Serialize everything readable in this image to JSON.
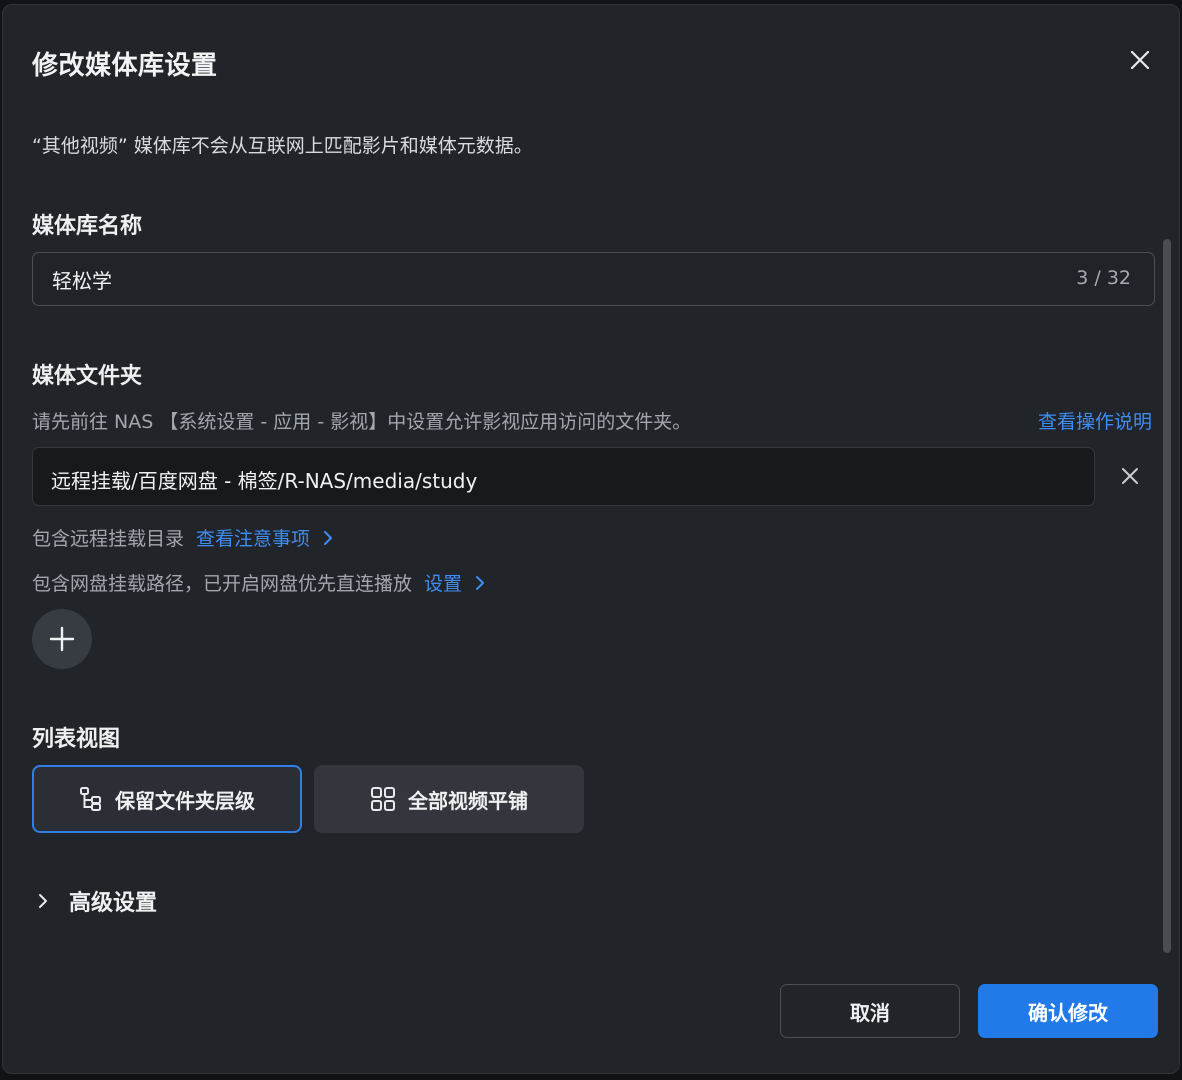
{
  "dialog": {
    "title": "修改媒体库设置",
    "description": "“其他视频” 媒体库不会从互联网上匹配影片和媒体元数据。"
  },
  "library_name": {
    "label": "媒体库名称",
    "value": "轻松学",
    "counter": "3 / 32"
  },
  "media_folder": {
    "label": "媒体文件夹",
    "hint": "请先前往 NAS 【系统设置 - 应用 - 影视】中设置允许影视应用访问的文件夹。",
    "help_link": "查看操作说明",
    "folders": [
      {
        "path": "远程挂载/百度网盘 - 棉签/R-NAS/media/study"
      }
    ],
    "remote_note": "包含远程挂载目录",
    "remote_link": "查看注意事项",
    "netdisk_note": "包含网盘挂载路径，已开启网盘优先直连播放",
    "netdisk_link": "设置"
  },
  "list_view": {
    "label": "列表视图",
    "options": [
      {
        "label": "保留文件夹层级",
        "icon": "folder-tree-icon",
        "selected": true
      },
      {
        "label": "全部视频平铺",
        "icon": "grid-icon",
        "selected": false
      }
    ]
  },
  "advanced": {
    "label": "高级设置"
  },
  "footer": {
    "cancel_label": "取消",
    "confirm_label": "确认修改"
  },
  "colors": {
    "accent": "#2279e8",
    "link": "#3d8ef3",
    "background": "#212429"
  }
}
